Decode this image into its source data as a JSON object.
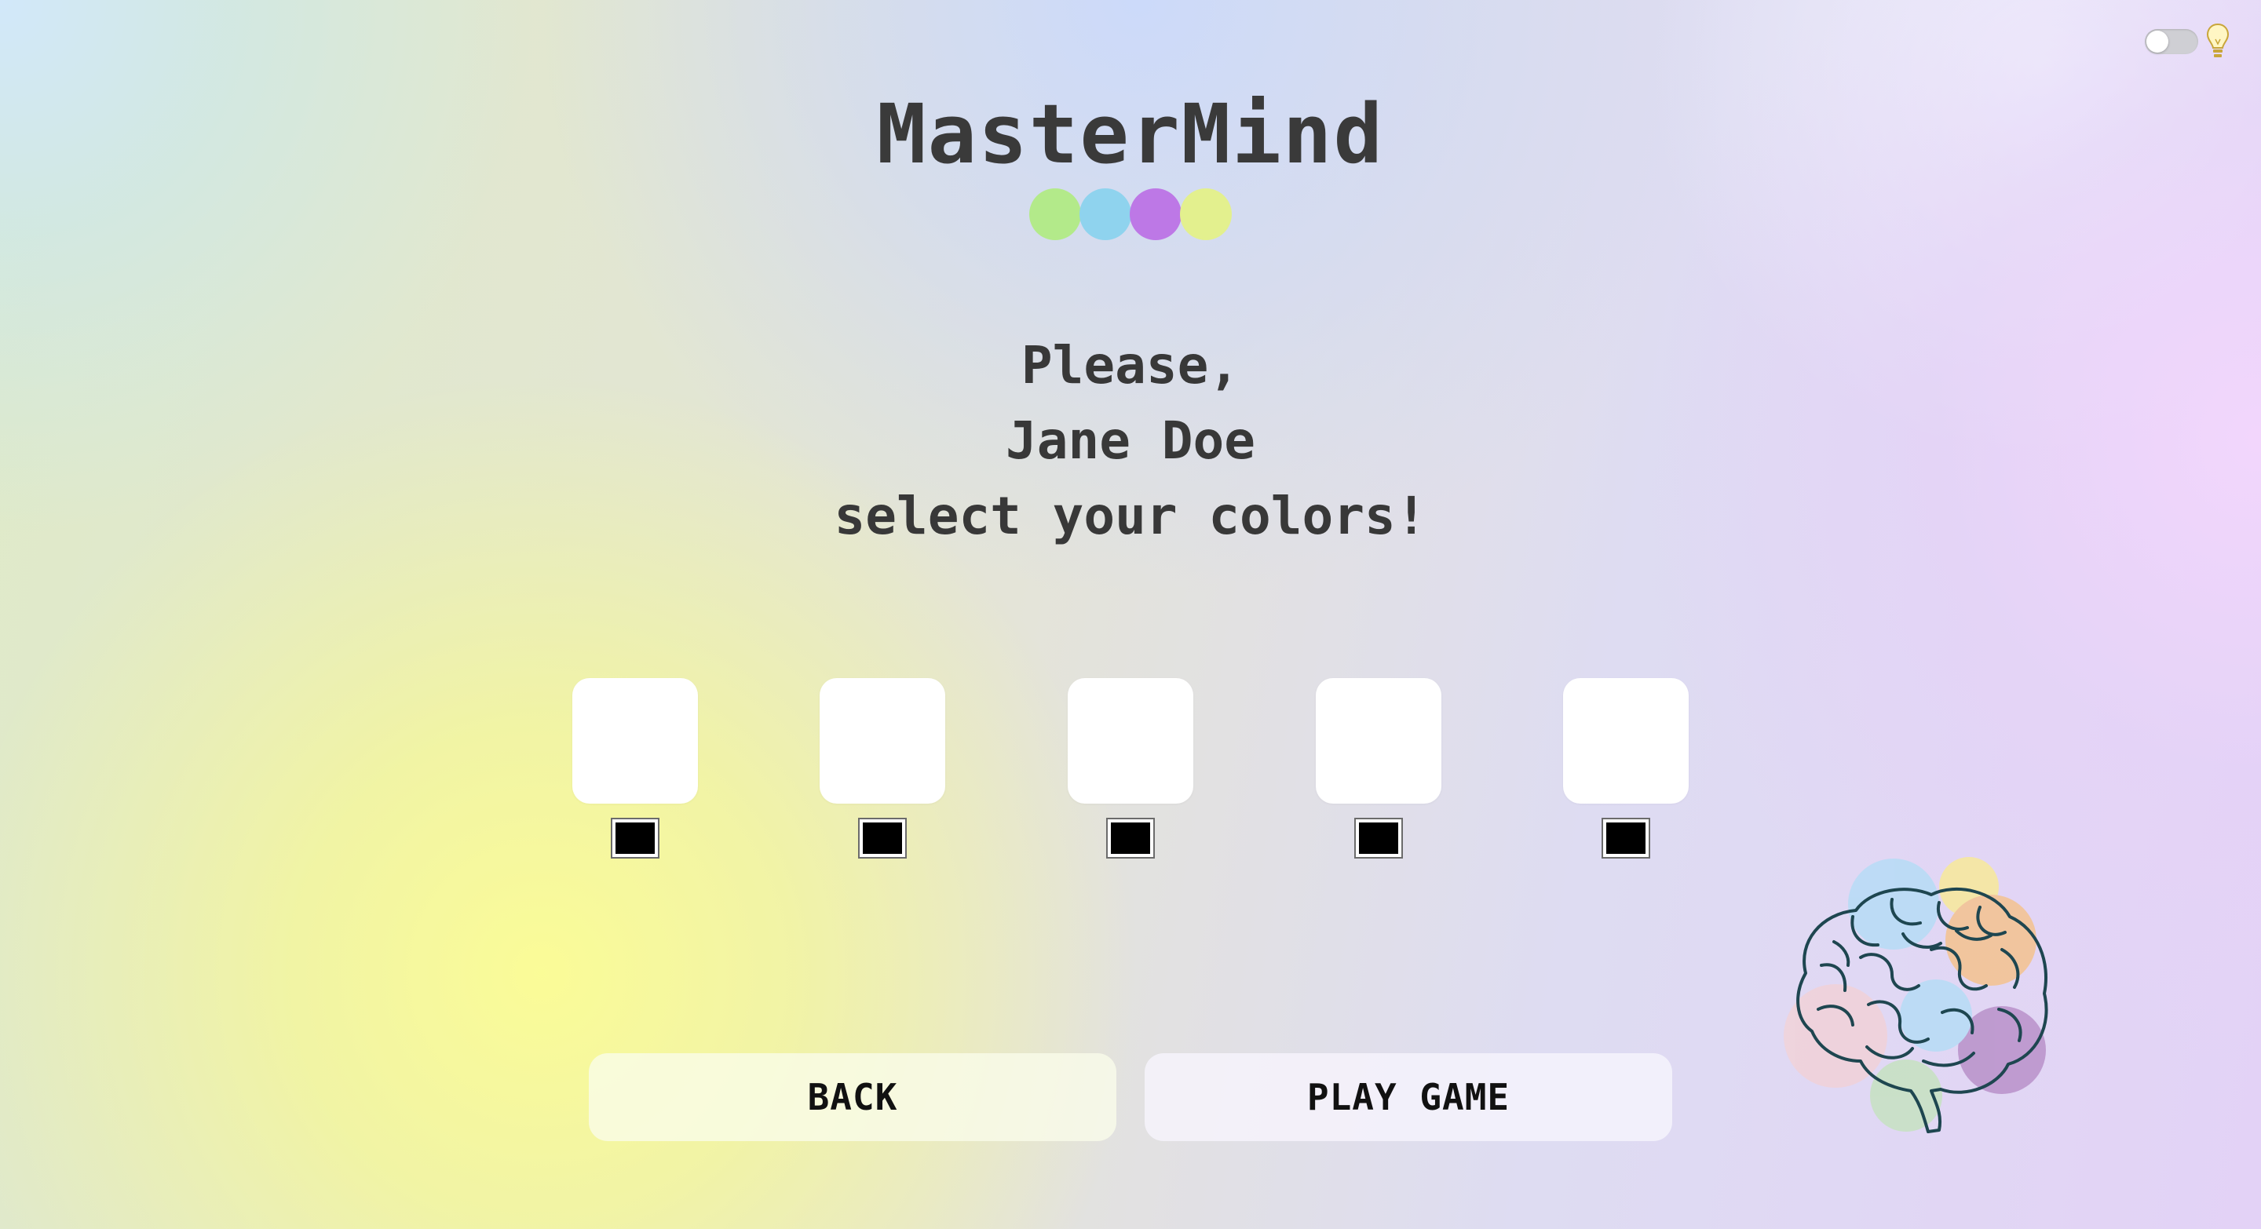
{
  "header": {
    "title": "MasterMind",
    "title_dot_colors": [
      "#b3ea8a",
      "#8fd3ee",
      "#bd78e6",
      "#e3f08e"
    ],
    "theme_toggle": {
      "state": "off",
      "icon": "lightbulb-icon"
    }
  },
  "prompt": {
    "line1": "Please,",
    "line2": "Jane Doe",
    "line3": "select your colors!"
  },
  "slots": [
    {
      "swatch_color": "#000000"
    },
    {
      "swatch_color": "#000000"
    },
    {
      "swatch_color": "#000000"
    },
    {
      "swatch_color": "#000000"
    },
    {
      "swatch_color": "#000000"
    }
  ],
  "buttons": {
    "back_label": "BACK",
    "play_label": "PLAY GAME"
  },
  "illustration": {
    "icon": "brain-icon",
    "blob_colors": [
      "#b6dcf6",
      "#f8e99a",
      "#f4c38f",
      "#f1d2d8",
      "#c6e2c1",
      "#b891c9"
    ]
  }
}
